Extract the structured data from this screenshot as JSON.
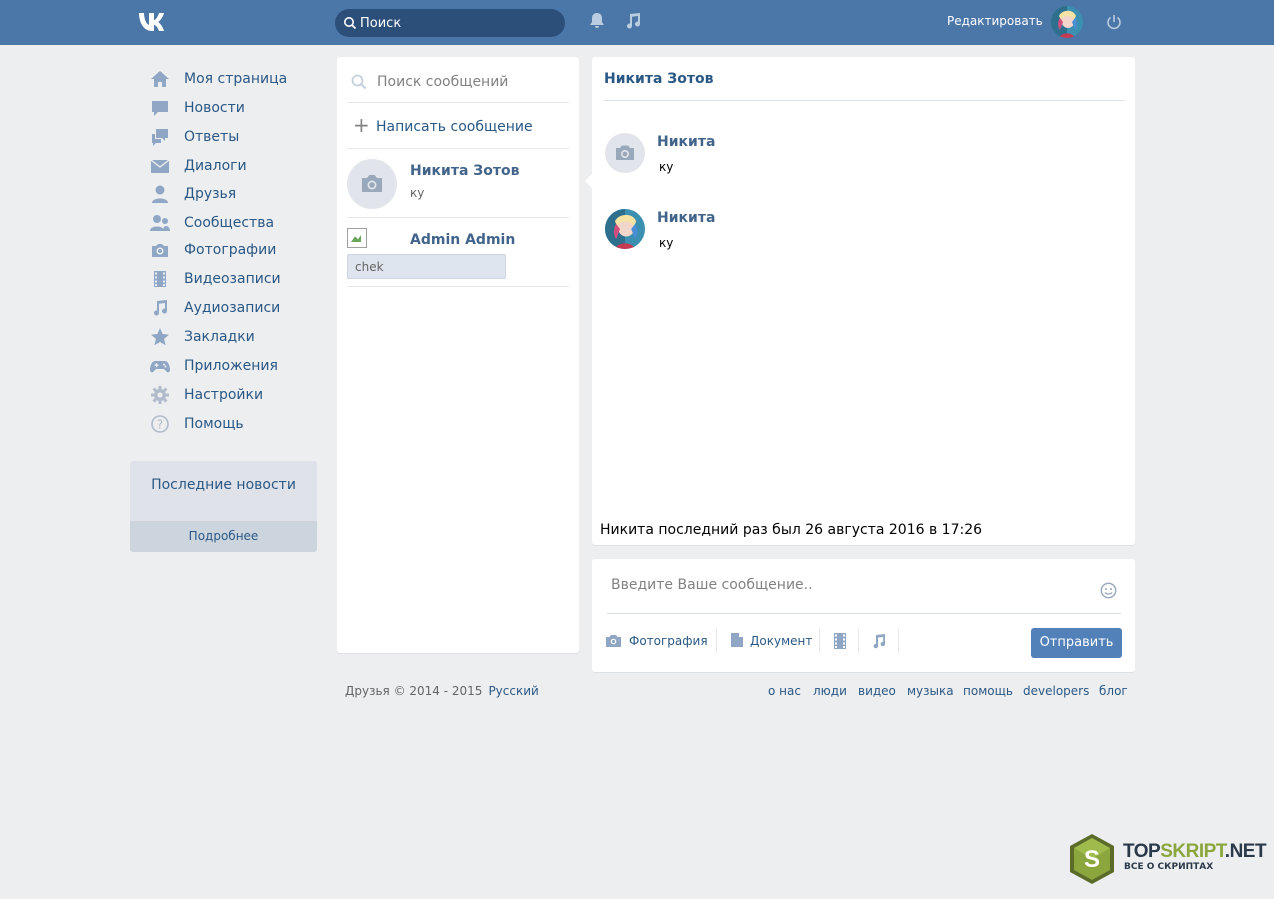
{
  "header": {
    "logo": "vk-logo",
    "search_label": "Поиск",
    "edit_label": "Редактировать"
  },
  "menu": [
    {
      "label": "Моя страница",
      "icon": "home-icon"
    },
    {
      "label": "Новости",
      "icon": "news-icon"
    },
    {
      "label": "Ответы",
      "icon": "replies-icon"
    },
    {
      "label": "Диалоги",
      "icon": "mail-icon"
    },
    {
      "label": "Друзья",
      "icon": "friend-icon"
    },
    {
      "label": "Сообщества",
      "icon": "groups-icon"
    },
    {
      "label": "Фотографии",
      "icon": "camera-icon"
    },
    {
      "label": "Видеозаписи",
      "icon": "film-icon"
    },
    {
      "label": "Аудиозаписи",
      "icon": "music-icon"
    },
    {
      "label": "Закладки",
      "icon": "star-icon"
    },
    {
      "label": "Приложения",
      "icon": "gamepad-icon"
    },
    {
      "label": "Настройки",
      "icon": "gear-icon"
    },
    {
      "label": "Помощь",
      "icon": "help-icon"
    }
  ],
  "news_box": {
    "title": "Последние новости",
    "more_label": "Подробнее"
  },
  "conversations": {
    "search_placeholder": "Поиск сообщений",
    "new_message_label": "Написать сообщение",
    "items": [
      {
        "name": "Никита Зотов",
        "preview": "ку"
      },
      {
        "name": "Admin Admin",
        "preview": "chek"
      }
    ]
  },
  "chat": {
    "title": "Никита Зотов",
    "messages": [
      {
        "author": "Никита",
        "text": "ку"
      },
      {
        "author": "Никита",
        "text": "ку"
      }
    ],
    "last_seen": "Никита последний раз был 26 августа 2016 в 17:26"
  },
  "compose": {
    "placeholder": "Введите Ваше сообщение..",
    "photo_label": "Фотография",
    "document_label": "Документ",
    "send_label": "Отправить"
  },
  "footer": {
    "copyright": "Друзья © 2014 - 2015",
    "language": "Русский",
    "links": [
      "о нас",
      "люди",
      "видео",
      "музыка",
      "помощь",
      "developers",
      "блог"
    ]
  },
  "watermark": {
    "part1": "TOP",
    "part2": "SKRIPT",
    "part3": ".NET",
    "subtitle": "ВСЕ О СКРИПТАХ",
    "letter": "S"
  },
  "colors": {
    "header": "#4a76a8",
    "background": "#edeef0",
    "link": "#2a5885",
    "button": "#5181b8"
  }
}
